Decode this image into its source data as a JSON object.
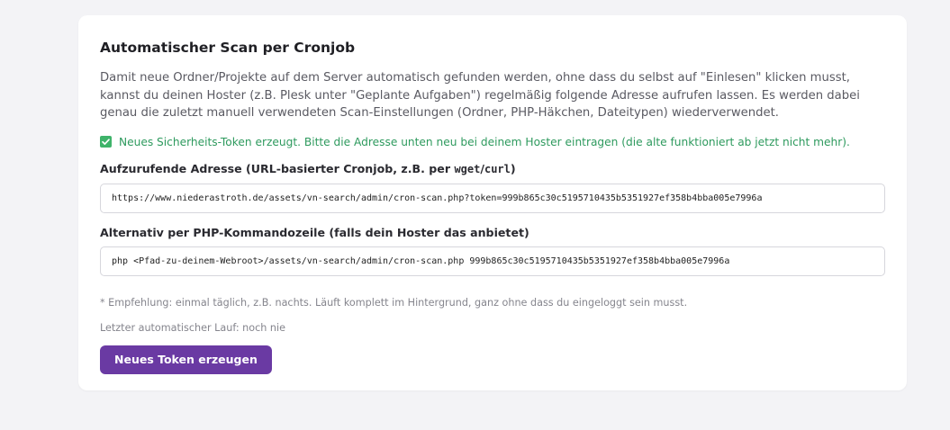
{
  "card": {
    "title": "Automatischer Scan per Cronjob",
    "description": "Damit neue Ordner/Projekte auf dem Server automatisch gefunden werden, ohne dass du selbst auf \"Einlesen\" klicken musst, kannst du deinen Hoster (z.B. Plesk unter \"Geplante Aufgaben\") regelmäßig folgende Adresse aufrufen lassen. Es werden dabei genau die zuletzt manuell verwendeten Scan-Einstellungen (Ordner, PHP-Häkchen, Dateitypen) wiederverwendet.",
    "success_message": "Neues Sicherheits-Token erzeugt. Bitte die Adresse unten neu bei deinem Hoster eintragen (die alte funktioniert ab jetzt nicht mehr).",
    "url_field": {
      "label_prefix": "Aufzurufende Adresse (URL-basierter Cronjob, z.B. per ",
      "label_code_1": "wget",
      "label_sep": "/",
      "label_code_2": "curl",
      "label_suffix": ")",
      "value": "https://www.niederastroth.de/assets/vn-search/admin/cron-scan.php?token=999b865c30c5195710435b5351927ef358b4bba005e7996a"
    },
    "cli_field": {
      "label": "Alternativ per PHP-Kommandozeile (falls dein Hoster das anbietet)",
      "value": "php <Pfad-zu-deinem-Webroot>/assets/vn-search/admin/cron-scan.php 999b865c30c5195710435b5351927ef358b4bba005e7996a"
    },
    "recommendation": "* Empfehlung: einmal täglich, z.B. nachts. Läuft komplett im Hintergrund, ganz ohne dass du eingeloggt sein musst.",
    "last_run": "Letzter automatischer Lauf: noch nie",
    "button_label": "Neues Token erzeugen"
  },
  "colors": {
    "accent": "#6a3aa3",
    "success": "#2e9a5e",
    "background": "#f3f3f6"
  },
  "icons": {
    "success": "check-square-icon"
  }
}
